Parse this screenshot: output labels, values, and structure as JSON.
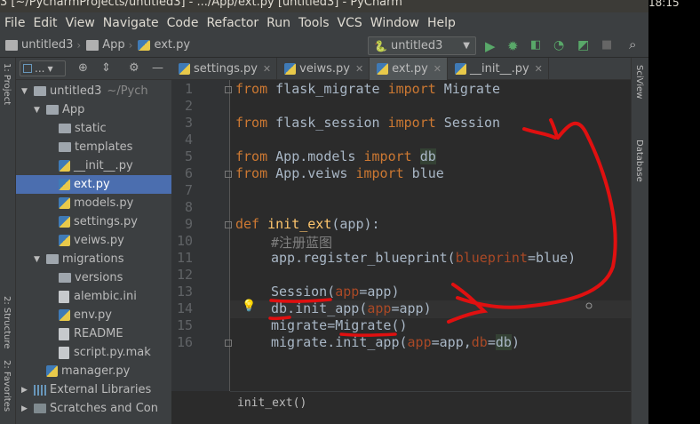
{
  "window": {
    "title": "3 [~/PycharmProjects/untitled3] - .../App/ext.py [untitled3] - PyCharm",
    "clock": "18:15"
  },
  "menu": [
    "File",
    "Edit",
    "View",
    "Navigate",
    "Code",
    "Refactor",
    "Run",
    "Tools",
    "VCS",
    "Window",
    "Help"
  ],
  "breadcrumbs": [
    "untitled3",
    "App",
    "ext.py"
  ],
  "run_config": "untitled3",
  "project_panel": {
    "view_label": "...",
    "tree": [
      {
        "label": "untitled3",
        "extra": "~/Pych",
        "kind": "folder",
        "expanded": true,
        "depth": 0
      },
      {
        "label": "App",
        "kind": "folder",
        "expanded": true,
        "depth": 1
      },
      {
        "label": "static",
        "kind": "folder",
        "depth": 2
      },
      {
        "label": "templates",
        "kind": "folder",
        "depth": 2
      },
      {
        "label": "__init__.py",
        "kind": "py",
        "depth": 2
      },
      {
        "label": "ext.py",
        "kind": "py",
        "depth": 2,
        "selected": true
      },
      {
        "label": "models.py",
        "kind": "py",
        "depth": 2
      },
      {
        "label": "settings.py",
        "kind": "py",
        "depth": 2
      },
      {
        "label": "veiws.py",
        "kind": "py",
        "depth": 2
      },
      {
        "label": "migrations",
        "kind": "folder",
        "expanded": true,
        "depth": 1
      },
      {
        "label": "versions",
        "kind": "folder",
        "depth": 2
      },
      {
        "label": "alembic.ini",
        "kind": "file",
        "depth": 2
      },
      {
        "label": "env.py",
        "kind": "py",
        "depth": 2
      },
      {
        "label": "README",
        "kind": "file",
        "depth": 2
      },
      {
        "label": "script.py.mak",
        "kind": "file",
        "depth": 2
      },
      {
        "label": "manager.py",
        "kind": "py",
        "depth": 1
      },
      {
        "label": "External Libraries",
        "kind": "lib",
        "depth": 0
      },
      {
        "label": "Scratches and Con",
        "kind": "scratch",
        "depth": 0
      }
    ]
  },
  "tabs": [
    {
      "label": "settings.py"
    },
    {
      "label": "veiws.py"
    },
    {
      "label": "ext.py",
      "active": true
    },
    {
      "label": "__init__.py"
    }
  ],
  "editor": {
    "line_numbers": [
      "1",
      "2",
      "3",
      "4",
      "5",
      "6",
      "7",
      "8",
      "9",
      "10",
      "11",
      "12",
      "13",
      "14",
      "15",
      "16"
    ],
    "lines": {
      "l1": {
        "kw1": "from",
        "mod": " flask_migrate ",
        "kw2": "import",
        "name": " Migrate"
      },
      "l3": {
        "kw1": "from",
        "mod": " flask_session ",
        "kw2": "import",
        "name": " Session"
      },
      "l5": {
        "kw1": "from",
        "mod": " App.models ",
        "kw2": "import",
        "name": "db"
      },
      "l6": {
        "kw1": "from",
        "mod": " App.veiws ",
        "kw2": "import",
        "name": " blue"
      },
      "l9": {
        "kw": "def",
        "fn": "init_ext",
        "rest": "(app):"
      },
      "l10": {
        "comment": "#注册蓝图"
      },
      "l11": {
        "pre": "app.register_blueprint(",
        "param": "blueprint",
        "post": "=blue)"
      },
      "l13": {
        "name": "Session",
        "open": "(",
        "param": "app",
        "post": "=app)"
      },
      "l14": {
        "name": "db",
        "mid": ".init_app(",
        "param": "app",
        "post": "=app)"
      },
      "l15": {
        "pre": "migrate=Migrate()"
      },
      "l16": {
        "pre": "migrate.init_app(",
        "p1": "app",
        "mid": "=app,",
        "p2": "db",
        "eq": "=",
        "db": "db",
        "close": ")"
      }
    }
  },
  "footer_breadcrumb": "init_ext()",
  "left_strip_labels": [
    "1: Project",
    "2: Structure",
    "2: Favorites"
  ],
  "right_strip_labels": [
    "SciView",
    "Database"
  ]
}
